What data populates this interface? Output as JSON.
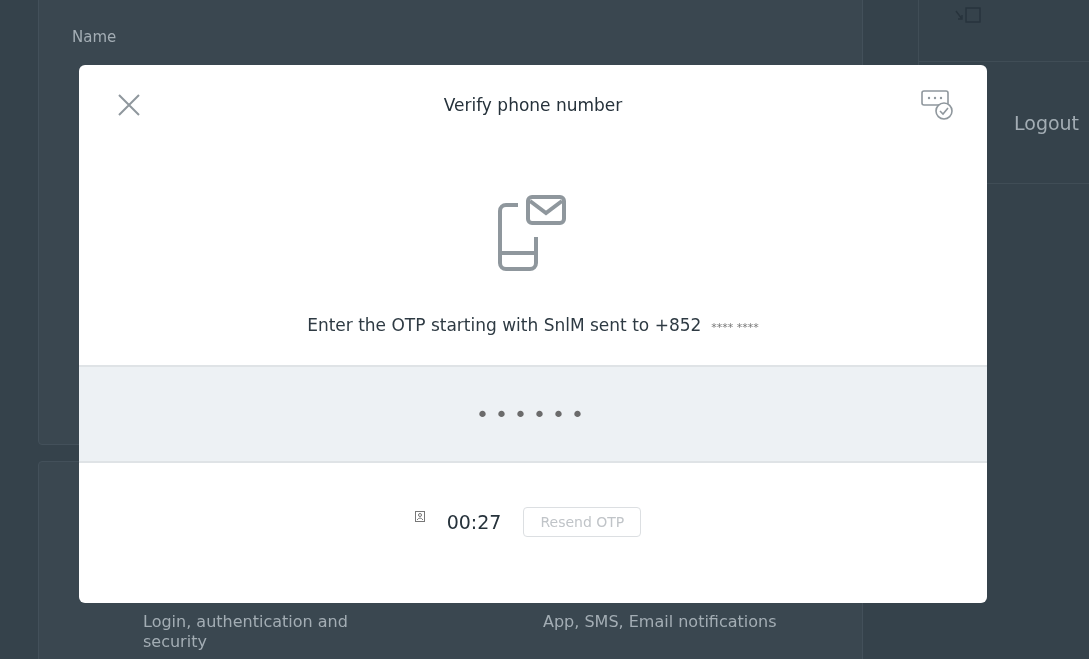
{
  "background": {
    "name_label": "Name",
    "logout": "Logout",
    "cards": [
      {
        "description": "Login, authentication and security"
      },
      {
        "description": "App, SMS, Email notifications"
      }
    ]
  },
  "modal": {
    "title": "Verify phone number",
    "instruction": "Enter the OTP starting with SnlM sent to +852",
    "masked_number": "**** ****",
    "otp_value": "••••••",
    "timer": "00:27",
    "resend_button": {
      "label": "Resend OTP",
      "disabled": true
    }
  }
}
